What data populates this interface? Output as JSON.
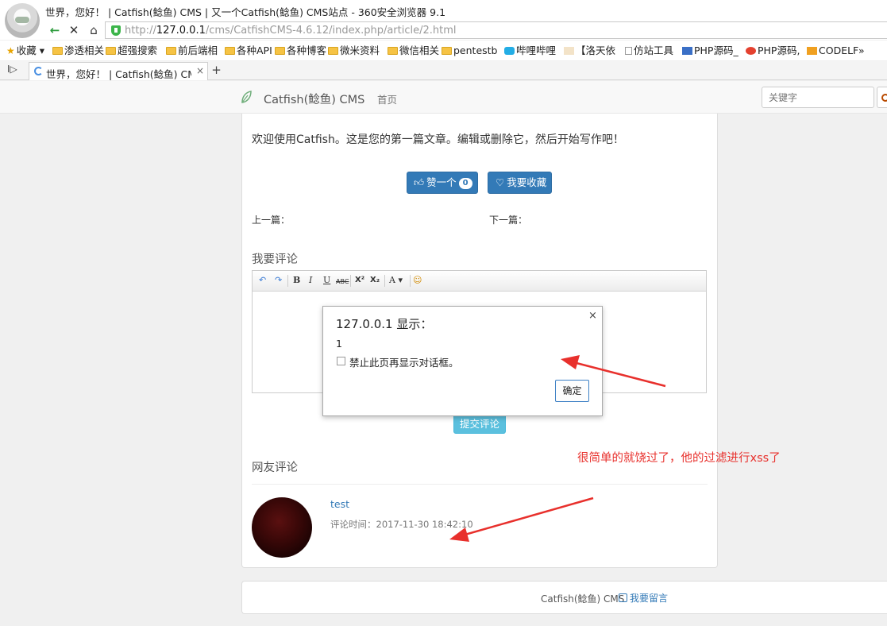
{
  "browser": {
    "window_title": "世界，您好！ | Catfish(鲶鱼) CMS | 又一个Catfish(鲶鱼) CMS站点 - 360安全浏览器 9.1",
    "url_prefix": "http://",
    "url_host": "127.0.0.1",
    "url_path": "/cms/CatfishCMS-4.6.12/index.php/article/2.html",
    "nav": {
      "back": "←",
      "stop": "✕",
      "home": "⌂"
    },
    "bookmarks": [
      "收藏",
      "渗透相关",
      "超强搜索",
      "前后端相",
      "各种API",
      "各种博客",
      "微米资料",
      "微信相关",
      "pentestb",
      "哔哩哔哩",
      "【洛天依",
      "仿站工具",
      "PHP源码_",
      "PHP源码,",
      "CODELF"
    ],
    "bookmarks_more": "»",
    "tab_nav": "I▷",
    "tab_title": "世界，您好！ | Catfish(鲶鱼) CMS",
    "tab_close": "×",
    "new_tab": "+"
  },
  "site": {
    "brand": "Catfish(鲶鱼) CMS",
    "nav_home": "首页",
    "search_placeholder": "关键字"
  },
  "article": {
    "body": "欢迎使用Catfish。这是您的第一篇文章。编辑或删除它，然后开始写作吧！",
    "like_label": "赞一个",
    "like_count": "0",
    "favorite_label": "我要收藏",
    "prev_label": "上一篇：",
    "next_label": "下一篇："
  },
  "comment_form": {
    "heading": "我要评论",
    "toolbar": {
      "undo": "↶",
      "redo": "↷",
      "bold": "B",
      "italic": "I",
      "underline": "U",
      "strike": "ABC",
      "sup": "X²",
      "sub": "X₂",
      "font_color": "A ▾",
      "emoji": "☺"
    },
    "submit": "提交评论"
  },
  "comments": {
    "heading": "网友评论",
    "items": [
      {
        "user": "test",
        "time": "评论时间：2017-11-30 18:42:10"
      }
    ]
  },
  "footer": {
    "brand": "Catfish(鲶鱼) CMS",
    "link": "我要留言"
  },
  "alert": {
    "title": "127.0.0.1 显示：",
    "message": "1",
    "checkbox_label": "禁止此页再显示对话框。",
    "ok": "确定",
    "close": "×"
  },
  "annotation": {
    "text": "很简单的就饶过了，他的过滤进行xss了",
    "color": "#e8302c"
  },
  "colors": {
    "primary": "#337ab7",
    "info": "#5bc0de",
    "secure": "#3cb54a"
  }
}
